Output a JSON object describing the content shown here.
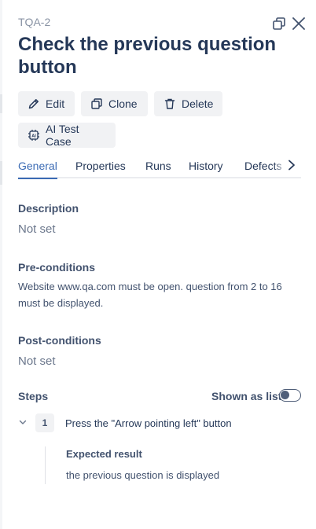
{
  "header": {
    "issue_key": "TQA-2",
    "title": "Check the previous question button",
    "icons": {
      "open_window": "open-in-window-icon",
      "close": "close-icon"
    }
  },
  "actions": {
    "edit": "Edit",
    "clone": "Clone",
    "delete": "Delete",
    "ai_test_case": "AI Test Case",
    "icons": [
      "pencil-icon",
      "clone-icon",
      "trash-icon",
      "ai-chip-icon"
    ]
  },
  "tabs": [
    {
      "label": "General",
      "active": true
    },
    {
      "label": "Properties",
      "active": false
    },
    {
      "label": "Runs",
      "active": false
    },
    {
      "label": "History",
      "active": false
    },
    {
      "label": "Defects",
      "active": false
    }
  ],
  "general": {
    "description": {
      "label": "Description",
      "value": "Not set"
    },
    "preconditions": {
      "label": "Pre-conditions",
      "value": "Website www.qa.com must be open. question from 2 to 16 must be displayed."
    },
    "postconditions": {
      "label": "Post-conditions",
      "value": "Not set"
    },
    "steps": {
      "label": "Steps",
      "toggle_label": "Shown as list",
      "toggle_on": false,
      "items": [
        {
          "number": "1",
          "action": "Press the \"Arrow pointing left\" button",
          "expected_label": "Expected result",
          "expected": "the previous question is displayed"
        }
      ]
    }
  },
  "colors": {
    "accent": "#3b6bb4",
    "title": "#253858",
    "muted": "#6b778c",
    "button_bg": "#f1f2f4"
  }
}
